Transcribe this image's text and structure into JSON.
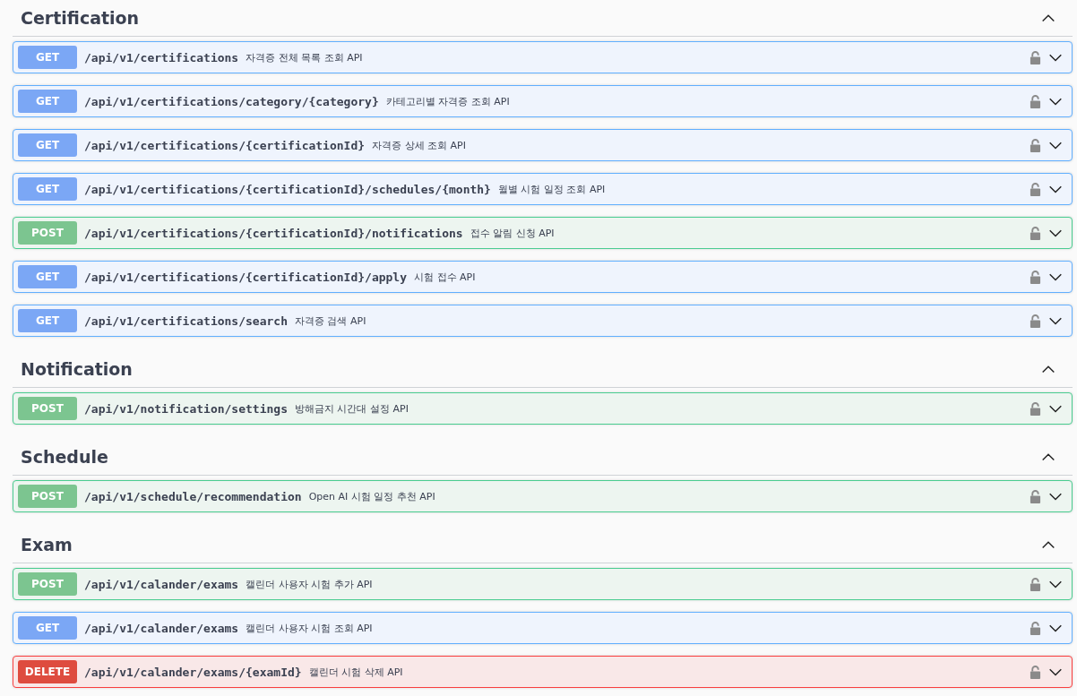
{
  "sections": [
    {
      "title": "Certification",
      "expanded": true,
      "operations": [
        {
          "method": "GET",
          "path": "/api/v1/certifications",
          "summary": "자격증 전체 목록 조회 API"
        },
        {
          "method": "GET",
          "path": "/api/v1/certifications/category/{category}",
          "summary": "카테고리별 자격증 조회 API"
        },
        {
          "method": "GET",
          "path": "/api/v1/certifications/{certificationId}",
          "summary": "자격증 상세 조회 API"
        },
        {
          "method": "GET",
          "path": "/api/v1/certifications/{certificationId}/schedules/{month}",
          "summary": "월별 시험 일정 조회 API"
        },
        {
          "method": "POST",
          "path": "/api/v1/certifications/{certificationId}/notifications",
          "summary": "접수 알림 신청 API"
        },
        {
          "method": "GET",
          "path": "/api/v1/certifications/{certificationId}/apply",
          "summary": "시험 접수 API"
        },
        {
          "method": "GET",
          "path": "/api/v1/certifications/search",
          "summary": "자격증 검색 API"
        }
      ]
    },
    {
      "title": "Notification",
      "expanded": true,
      "operations": [
        {
          "method": "POST",
          "path": "/api/v1/notification/settings",
          "summary": "방해금지 시간대 설정 API"
        }
      ]
    },
    {
      "title": "Schedule",
      "expanded": true,
      "operations": [
        {
          "method": "POST",
          "path": "/api/v1/schedule/recommendation",
          "summary": "Open AI 시험 일정 추천 API"
        }
      ]
    },
    {
      "title": "Exam",
      "expanded": true,
      "operations": [
        {
          "method": "POST",
          "path": "/api/v1/calander/exams",
          "summary": "캘린더 사용자 시험 추가 API"
        },
        {
          "method": "GET",
          "path": "/api/v1/calander/exams",
          "summary": "캘린더 사용자 시험 조회 API"
        },
        {
          "method": "DELETE",
          "path": "/api/v1/calander/exams/{examId}",
          "summary": "캘린더 시험 삭제 API"
        }
      ]
    }
  ]
}
